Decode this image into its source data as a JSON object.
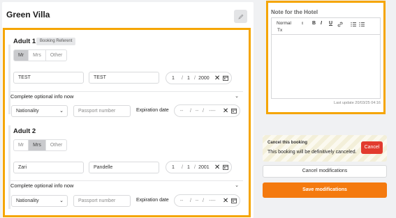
{
  "hotel": {
    "name": "Green Villa"
  },
  "adult1": {
    "title": "Adult 1",
    "badge": "Booking Referent",
    "titles": [
      "Mr",
      "Mrs",
      "Other"
    ],
    "first_name": "TEST",
    "last_name": "TEST",
    "dob": {
      "day": "1",
      "month": "1",
      "year": "2000",
      "sep": "/"
    },
    "optional_label": "Complete optional info now",
    "nationality": "Nationality",
    "passport_placeholder": "Passport number",
    "expiration_label": "Expiration date",
    "exp_date": {
      "day": "--",
      "month": "--",
      "year": "----",
      "sep": "/"
    }
  },
  "adult2": {
    "title": "Adult 2",
    "titles": [
      "Mr",
      "Mrs",
      "Other"
    ],
    "first_name": "Zari",
    "last_name": "Pandelle",
    "dob": {
      "day": "1",
      "month": "1",
      "year": "2001",
      "sep": "/"
    },
    "optional_label": "Complete optional info now",
    "nationality": "Nationality",
    "passport_placeholder": "Passport number",
    "expiration_label": "Expiration date",
    "exp_date": {
      "day": "--",
      "month": "--",
      "year": "----",
      "sep": "/"
    }
  },
  "note": {
    "title": "Note for the Hotel",
    "format_select": "Normal",
    "last_update": "Last update 20/03/25 04:16"
  },
  "cancel": {
    "title": "Cancel this booking",
    "message": "This booking will be definitively canceled.",
    "button": "Cancel"
  },
  "actions": {
    "cancel_modifications": "Cancel modifications",
    "save_modifications": "Save modifications"
  },
  "glyphs": {
    "clear": "✕",
    "chevron": "⌄",
    "select_arrows": "⇕",
    "bold": "B",
    "italic": "I",
    "underline": "U",
    "clear_format": "Tx"
  },
  "colors": {
    "accent": "#f47a0f",
    "highlight_border": "#f5a500",
    "danger": "#e23b2e"
  }
}
